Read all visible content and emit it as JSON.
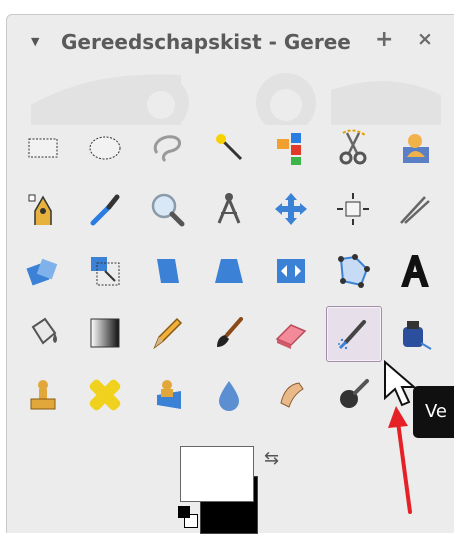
{
  "window": {
    "title": "Gereedschapskist - Geree",
    "add_label": "+",
    "close_label": "×"
  },
  "tooltip": {
    "text": "Ve"
  },
  "tools": [
    {
      "name": "rect-select",
      "icon": "rect-select-icon"
    },
    {
      "name": "ellipse-select",
      "icon": "ellipse-select-icon"
    },
    {
      "name": "free-select",
      "icon": "lasso-icon"
    },
    {
      "name": "fuzzy-select",
      "icon": "magic-wand-icon"
    },
    {
      "name": "select-by-color",
      "icon": "color-select-icon"
    },
    {
      "name": "scissors-select",
      "icon": "scissors-icon"
    },
    {
      "name": "foreground-select",
      "icon": "foreground-select-icon"
    },
    {
      "name": "paths",
      "icon": "paths-icon"
    },
    {
      "name": "color-picker",
      "icon": "eyedropper-icon"
    },
    {
      "name": "zoom",
      "icon": "magnifier-icon"
    },
    {
      "name": "measure",
      "icon": "compass-icon"
    },
    {
      "name": "move",
      "icon": "move-icon"
    },
    {
      "name": "align",
      "icon": "align-icon"
    },
    {
      "name": "crop",
      "icon": "crop-icon"
    },
    {
      "name": "rotate",
      "icon": "rotate-icon"
    },
    {
      "name": "scale",
      "icon": "scale-icon"
    },
    {
      "name": "shear",
      "icon": "shear-icon"
    },
    {
      "name": "perspective",
      "icon": "perspective-icon"
    },
    {
      "name": "flip",
      "icon": "flip-icon"
    },
    {
      "name": "cage-transform",
      "icon": "cage-icon"
    },
    {
      "name": "text",
      "icon": "text-icon"
    },
    {
      "name": "bucket-fill",
      "icon": "bucket-icon"
    },
    {
      "name": "blend",
      "icon": "gradient-icon"
    },
    {
      "name": "pencil",
      "icon": "pencil-icon"
    },
    {
      "name": "paintbrush",
      "icon": "brush-icon"
    },
    {
      "name": "eraser",
      "icon": "eraser-icon"
    },
    {
      "name": "airbrush",
      "icon": "airbrush-icon"
    },
    {
      "name": "ink",
      "icon": "ink-icon"
    },
    {
      "name": "clone",
      "icon": "clone-stamp-icon"
    },
    {
      "name": "heal",
      "icon": "heal-icon"
    },
    {
      "name": "perspective-clone",
      "icon": "perspective-clone-icon"
    },
    {
      "name": "blur-sharpen",
      "icon": "water-drop-icon"
    },
    {
      "name": "smudge",
      "icon": "smudge-icon"
    },
    {
      "name": "dodge-burn",
      "icon": "dodge-burn-icon"
    }
  ],
  "active_tool": "airbrush",
  "colors": {
    "foreground": "#ffffff",
    "background": "#000000",
    "accent": "#e52026"
  }
}
